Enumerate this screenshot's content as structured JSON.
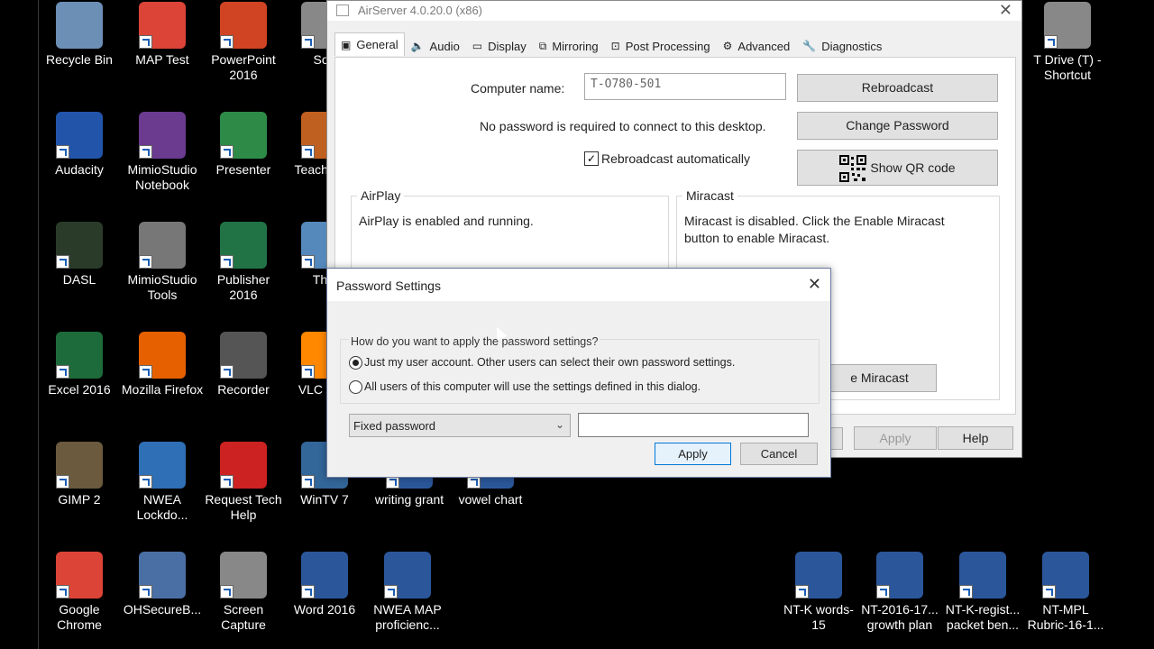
{
  "desktop": {
    "icons": [
      {
        "label": "Recycle Bin"
      },
      {
        "label": "MAP Test"
      },
      {
        "label": "PowerPoint 2016"
      },
      {
        "label": "Sou"
      },
      {
        "label": "Audacity"
      },
      {
        "label": "MimioStudio Notebook"
      },
      {
        "label": "Presenter"
      },
      {
        "label": "Teach Rea"
      },
      {
        "label": "DASL"
      },
      {
        "label": "MimioStudio Tools"
      },
      {
        "label": "Publisher 2016"
      },
      {
        "label": "This"
      },
      {
        "label": "Excel 2016"
      },
      {
        "label": "Mozilla Firefox"
      },
      {
        "label": "Recorder"
      },
      {
        "label": "VLC r pla"
      },
      {
        "label": "GIMP 2"
      },
      {
        "label": "NWEA Lockdo..."
      },
      {
        "label": "Request Tech Help"
      },
      {
        "label": "WinTV 7"
      },
      {
        "label": "writing grant"
      },
      {
        "label": "vowel chart"
      },
      {
        "label": "Google Chrome"
      },
      {
        "label": "OHSecureB..."
      },
      {
        "label": "Screen Capture"
      },
      {
        "label": "Word 2016"
      },
      {
        "label": "NWEA MAP proficienc..."
      },
      {
        "label": "T Drive (T) - Shortcut"
      },
      {
        "label": "NT-K words-15"
      },
      {
        "label": "NT-2016-17... growth plan"
      },
      {
        "label": "NT-K-regist... packet ben..."
      },
      {
        "label": "NT-MPL Rubric-16-1..."
      }
    ]
  },
  "airserver": {
    "title": "AirServer 4.0.20.0 (x86)",
    "tabs": [
      "General",
      "Audio",
      "Display",
      "Mirroring",
      "Post Processing",
      "Advanced",
      "Diagnostics"
    ],
    "active_tab": "General",
    "computer_name_label": "Computer name:",
    "computer_name_value": "T-O780-501",
    "rebroadcast_button": "Rebroadcast",
    "no_password_text": "No password is required to connect to this desktop.",
    "change_password_button": "Change Password",
    "rebroadcast_auto_label": "Rebroadcast automatically",
    "rebroadcast_auto_checked": true,
    "qr_button": "Show QR code",
    "airplay_title": "AirPlay",
    "airplay_text": "AirPlay is enabled and running.",
    "miracast_title": "Miracast",
    "miracast_text_1": "Miracast is disabled. Click the Enable Miracast",
    "miracast_text_2": "button to enable Miracast.",
    "miracast_button_partial": "e Miracast",
    "apply_button": "Apply",
    "help_button": "Help"
  },
  "password_dialog": {
    "title": "Password Settings",
    "question": "How do you want to apply the password settings?",
    "option_1": "Just my user account. Other users can select their own password settings.",
    "option_2": "All users of this computer will use the settings defined in this dialog.",
    "selected_option": 1,
    "password_type": "Fixed password",
    "password_value": "",
    "apply_button": "Apply",
    "cancel_button": "Cancel"
  },
  "colors": {
    "desktop_bg": "#000000",
    "accent_blue": "#0078d7",
    "dialog_bg": "#f0f0f0"
  }
}
